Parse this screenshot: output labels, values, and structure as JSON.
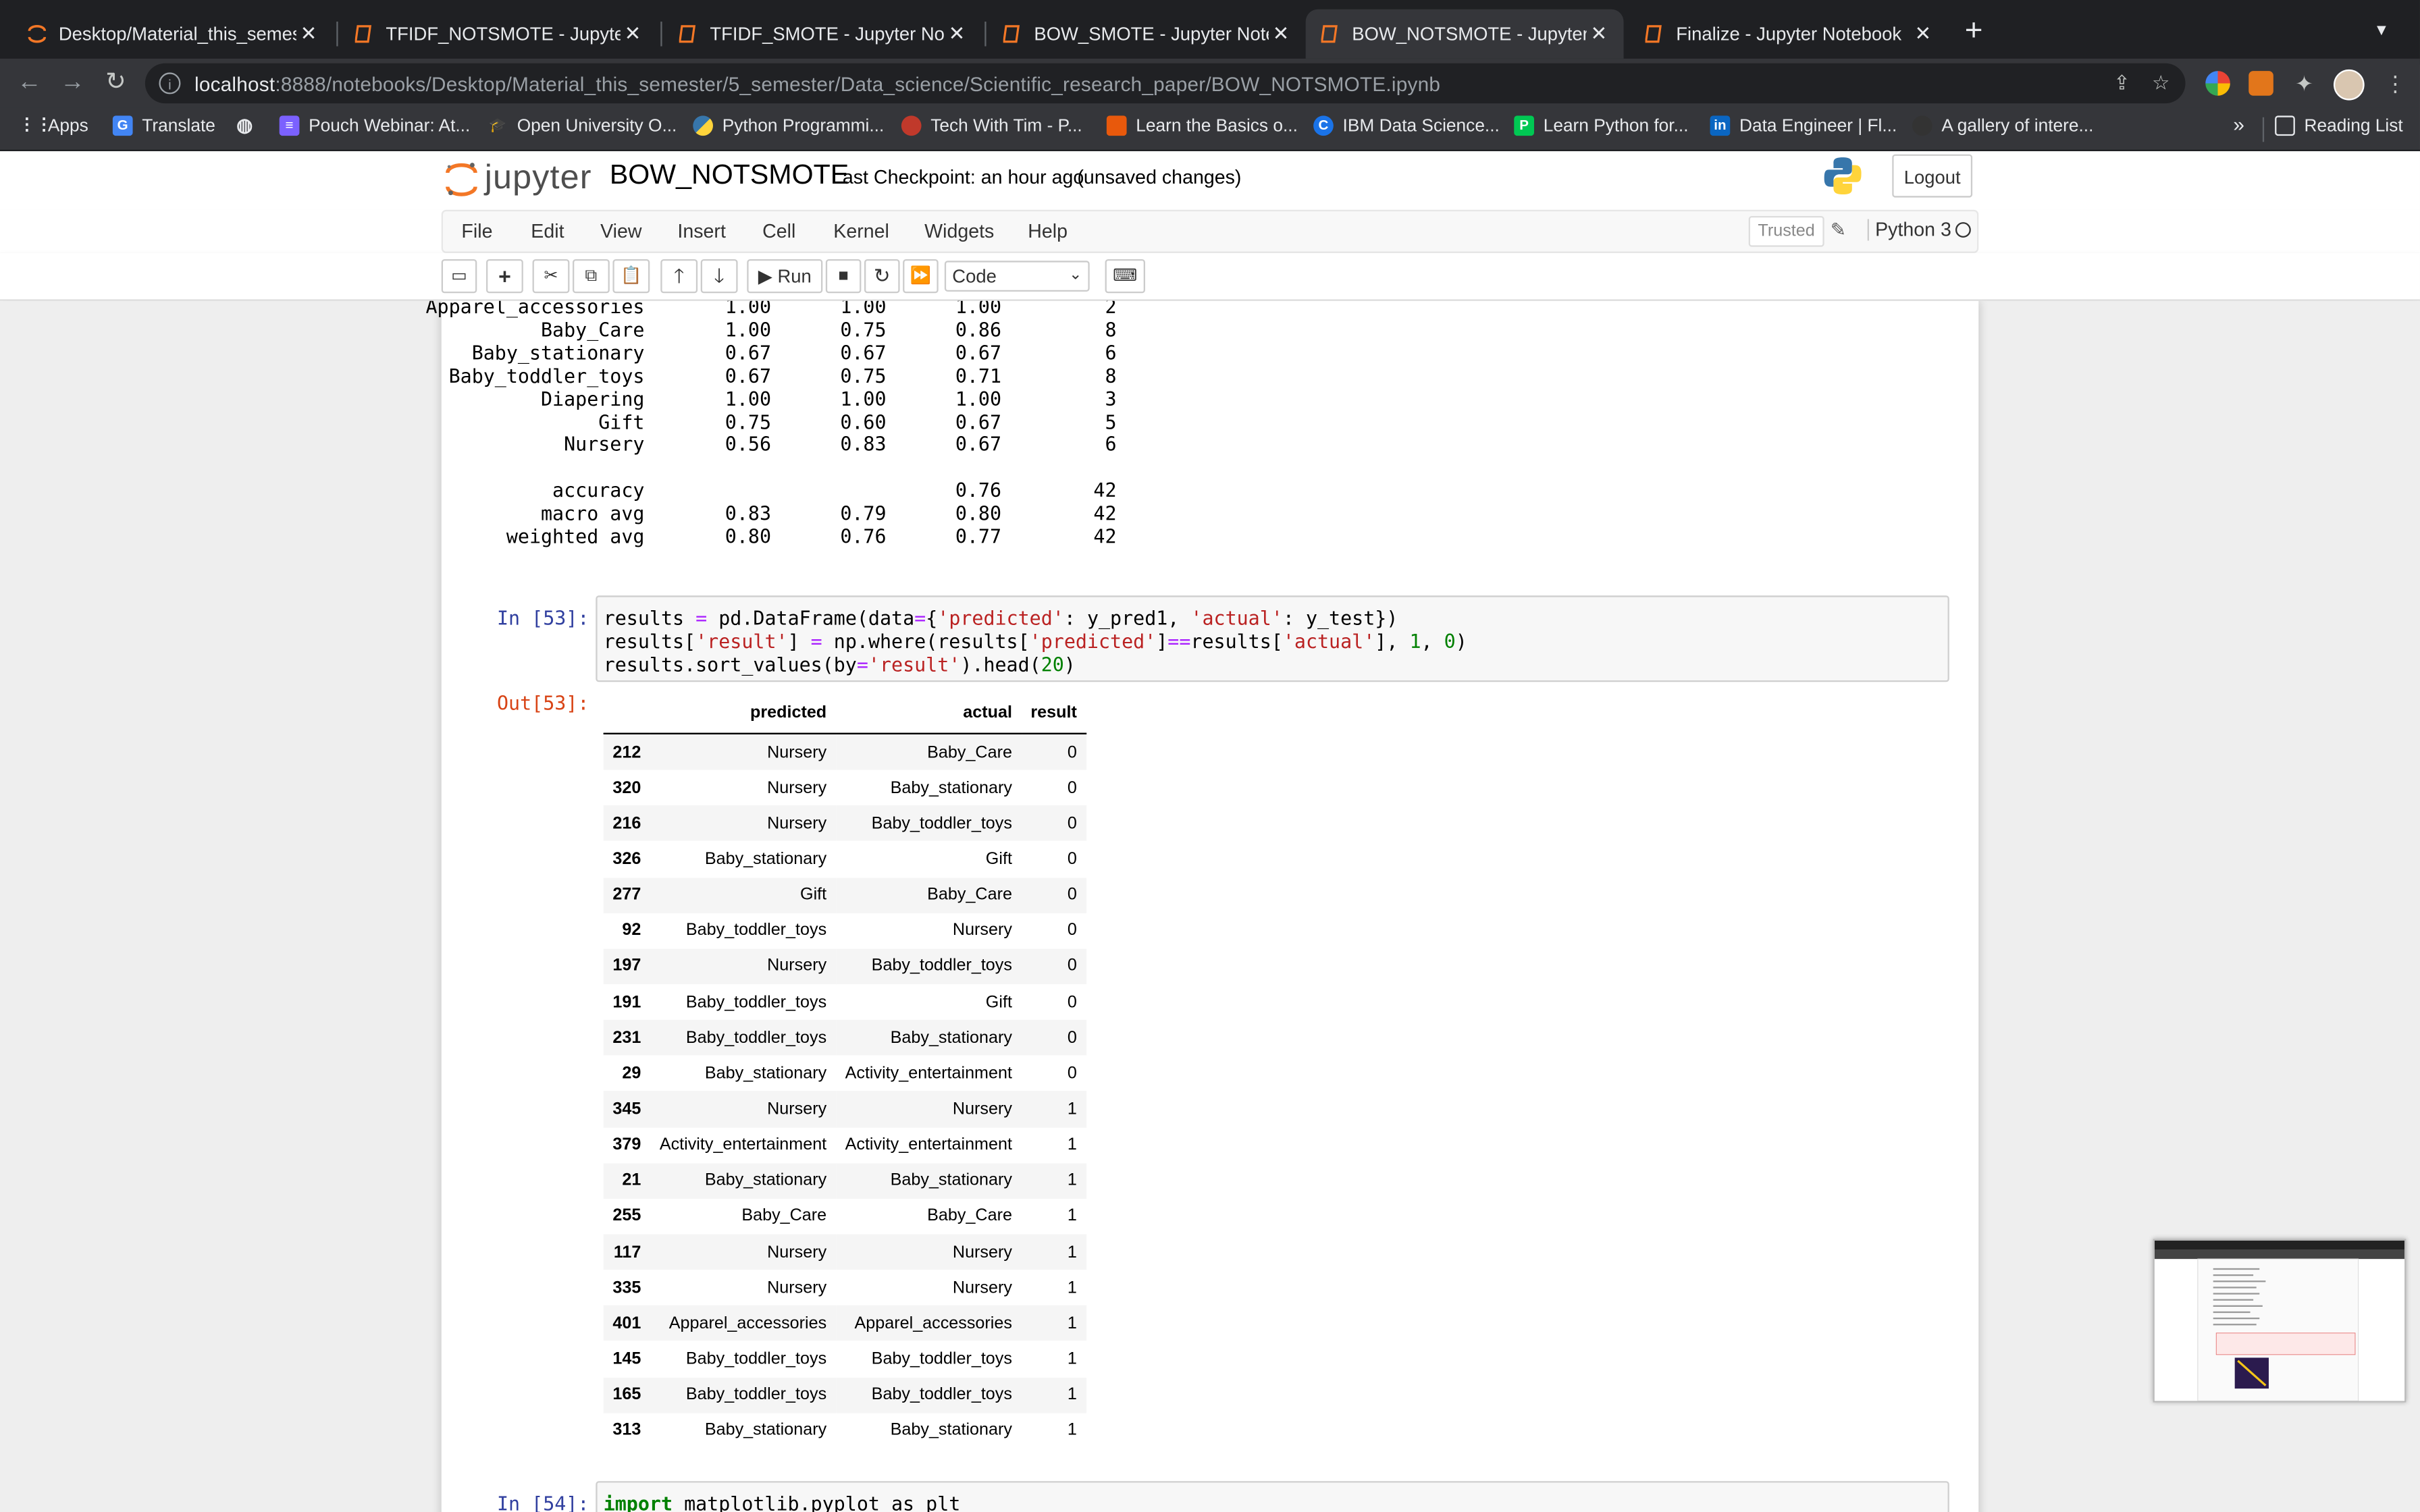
{
  "browser": {
    "tabs": [
      {
        "title": "Desktop/Material_this_semeste",
        "active": false
      },
      {
        "title": "TFIDF_NOTSMOTE - Jupyter N",
        "active": false
      },
      {
        "title": "TFIDF_SMOTE - Jupyter Noteb",
        "active": false
      },
      {
        "title": "BOW_SMOTE - Jupyter Notebo",
        "active": false
      },
      {
        "title": "BOW_NOTSMOTE - Jupyter No",
        "active": true
      },
      {
        "title": "Finalize - Jupyter Notebook",
        "active": false
      }
    ],
    "url_host": "localhost",
    "url_path": ":8888/notebooks/Desktop/Material_this_semester/5_semester/Data_science/Scientific_research_paper/BOW_NOTSMOTE.ipynb",
    "bookmarks": [
      "Apps",
      "Translate",
      "",
      "Pouch Webinar: At...",
      "Open University O...",
      "Python Programmi...",
      "Tech With Tim - P...",
      "Learn the Basics o...",
      "IBM Data Science...",
      "Learn Python for...",
      "Data Engineer | Fl...",
      "A gallery of intere..."
    ],
    "overflow": "»",
    "reading_list": "Reading List"
  },
  "jupyter": {
    "logo_text": "jupyter",
    "notebook_name": "BOW_NOTSMOTE",
    "checkpoint": "Last Checkpoint: an hour ago",
    "unsaved": "(unsaved changes)",
    "logout": "Logout",
    "menu": [
      "File",
      "Edit",
      "View",
      "Insert",
      "Cell",
      "Kernel",
      "Widgets",
      "Help"
    ],
    "trusted": "Trusted",
    "kernel": "Python 3",
    "run_label": "Run",
    "cell_type": "Code"
  },
  "report": {
    "rows": [
      {
        "label": "Apparel_accessories",
        "precision": "1.00",
        "recall": "1.00",
        "f1": "1.00",
        "support": "2"
      },
      {
        "label": "Baby_Care",
        "precision": "1.00",
        "recall": "0.75",
        "f1": "0.86",
        "support": "8"
      },
      {
        "label": "Baby_stationary",
        "precision": "0.67",
        "recall": "0.67",
        "f1": "0.67",
        "support": "6"
      },
      {
        "label": "Baby_toddler_toys",
        "precision": "0.67",
        "recall": "0.75",
        "f1": "0.71",
        "support": "8"
      },
      {
        "label": "Diapering",
        "precision": "1.00",
        "recall": "1.00",
        "f1": "1.00",
        "support": "3"
      },
      {
        "label": "Gift",
        "precision": "0.75",
        "recall": "0.60",
        "f1": "0.67",
        "support": "5"
      },
      {
        "label": "Nursery",
        "precision": "0.56",
        "recall": "0.83",
        "f1": "0.67",
        "support": "6"
      }
    ],
    "summary": [
      {
        "label": "accuracy",
        "precision": "",
        "recall": "",
        "f1": "0.76",
        "support": "42"
      },
      {
        "label": "macro avg",
        "precision": "0.83",
        "recall": "0.79",
        "f1": "0.80",
        "support": "42"
      },
      {
        "label": "weighted avg",
        "precision": "0.80",
        "recall": "0.76",
        "f1": "0.77",
        "support": "42"
      }
    ]
  },
  "cell53": {
    "in_prompt": "In [53]:",
    "out_prompt": "Out[53]:",
    "line1": "results = pd.DataFrame(data={'predicted': y_pred1, 'actual': y_test})",
    "line2": "results['result'] = np.where(results['predicted']==results['actual'], 1, 0)",
    "line3": "results.sort_values(by='result').head(20)",
    "table": {
      "columns": [
        "predicted",
        "actual",
        "result"
      ],
      "rows": [
        {
          "index": "212",
          "predicted": "Nursery",
          "actual": "Baby_Care",
          "result": "0"
        },
        {
          "index": "320",
          "predicted": "Nursery",
          "actual": "Baby_stationary",
          "result": "0"
        },
        {
          "index": "216",
          "predicted": "Nursery",
          "actual": "Baby_toddler_toys",
          "result": "0"
        },
        {
          "index": "326",
          "predicted": "Baby_stationary",
          "actual": "Gift",
          "result": "0"
        },
        {
          "index": "277",
          "predicted": "Gift",
          "actual": "Baby_Care",
          "result": "0"
        },
        {
          "index": "92",
          "predicted": "Baby_toddler_toys",
          "actual": "Nursery",
          "result": "0"
        },
        {
          "index": "197",
          "predicted": "Nursery",
          "actual": "Baby_toddler_toys",
          "result": "0"
        },
        {
          "index": "191",
          "predicted": "Baby_toddler_toys",
          "actual": "Gift",
          "result": "0"
        },
        {
          "index": "231",
          "predicted": "Baby_toddler_toys",
          "actual": "Baby_stationary",
          "result": "0"
        },
        {
          "index": "29",
          "predicted": "Baby_stationary",
          "actual": "Activity_entertainment",
          "result": "0"
        },
        {
          "index": "345",
          "predicted": "Nursery",
          "actual": "Nursery",
          "result": "1"
        },
        {
          "index": "379",
          "predicted": "Activity_entertainment",
          "actual": "Activity_entertainment",
          "result": "1"
        },
        {
          "index": "21",
          "predicted": "Baby_stationary",
          "actual": "Baby_stationary",
          "result": "1"
        },
        {
          "index": "255",
          "predicted": "Baby_Care",
          "actual": "Baby_Care",
          "result": "1"
        },
        {
          "index": "117",
          "predicted": "Nursery",
          "actual": "Nursery",
          "result": "1"
        },
        {
          "index": "335",
          "predicted": "Nursery",
          "actual": "Nursery",
          "result": "1"
        },
        {
          "index": "401",
          "predicted": "Apparel_accessories",
          "actual": "Apparel_accessories",
          "result": "1"
        },
        {
          "index": "145",
          "predicted": "Baby_toddler_toys",
          "actual": "Baby_toddler_toys",
          "result": "1"
        },
        {
          "index": "165",
          "predicted": "Baby_toddler_toys",
          "actual": "Baby_toddler_toys",
          "result": "1"
        },
        {
          "index": "313",
          "predicted": "Baby_stationary",
          "actual": "Baby_stationary",
          "result": "1"
        }
      ]
    }
  },
  "cell54": {
    "in_prompt": "In [54]:",
    "line1": "import matplotlib.pyplot as plt"
  },
  "colors": {
    "chrome_dark": "#1f2023",
    "chrome_tab": "#35363a",
    "prompt_in": "#303f9f",
    "prompt_out": "#d84315",
    "jupyter_orange": "#f37726"
  }
}
